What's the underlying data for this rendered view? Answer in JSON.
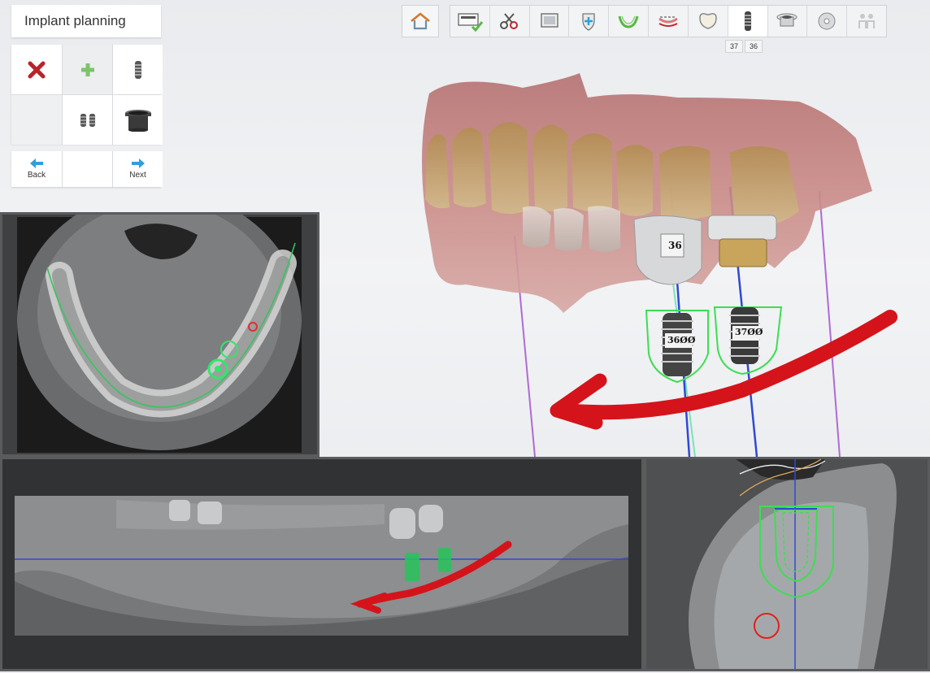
{
  "panel": {
    "title": "Implant planning",
    "tools": [
      {
        "name": "delete-implant",
        "icon": "red-x-icon"
      },
      {
        "name": "add-implant",
        "icon": "green-plus-icon"
      },
      {
        "name": "single-implant",
        "icon": "implant-screw-icon"
      },
      {
        "name": "empty",
        "icon": ""
      },
      {
        "name": "multiple-implants",
        "icon": "double-implant-icon"
      },
      {
        "name": "sleeve",
        "icon": "sleeve-cylinder-icon"
      }
    ],
    "nav": {
      "back_label": "Back",
      "next_label": "Next"
    }
  },
  "workflow": {
    "steps": [
      "scan-settings-icon",
      "trim-icon",
      "ct-image-icon",
      "prepare-icon",
      "margin-icon",
      "occlusion-icon",
      "crown-icon",
      "implant-icon",
      "sleeve-icon",
      "export-disc-icon",
      "people-icon"
    ],
    "current_step": 7,
    "completed_step": 0,
    "tooth_tabs": [
      "37",
      "36"
    ]
  },
  "view3d": {
    "implant_labels": [
      "36",
      "37"
    ],
    "crown_label": "36",
    "implant_text": [
      "36ØØ",
      "37ØØ"
    ]
  },
  "colors": {
    "accent_blue": "#2f9fd8",
    "delete_red": "#c0262c",
    "add_green": "#6fbf5f",
    "guide_green": "#3cde52",
    "arrow_red": "#d4141a",
    "axis_blue": "#2f48d6",
    "axis_purple": "#b06ad6"
  }
}
